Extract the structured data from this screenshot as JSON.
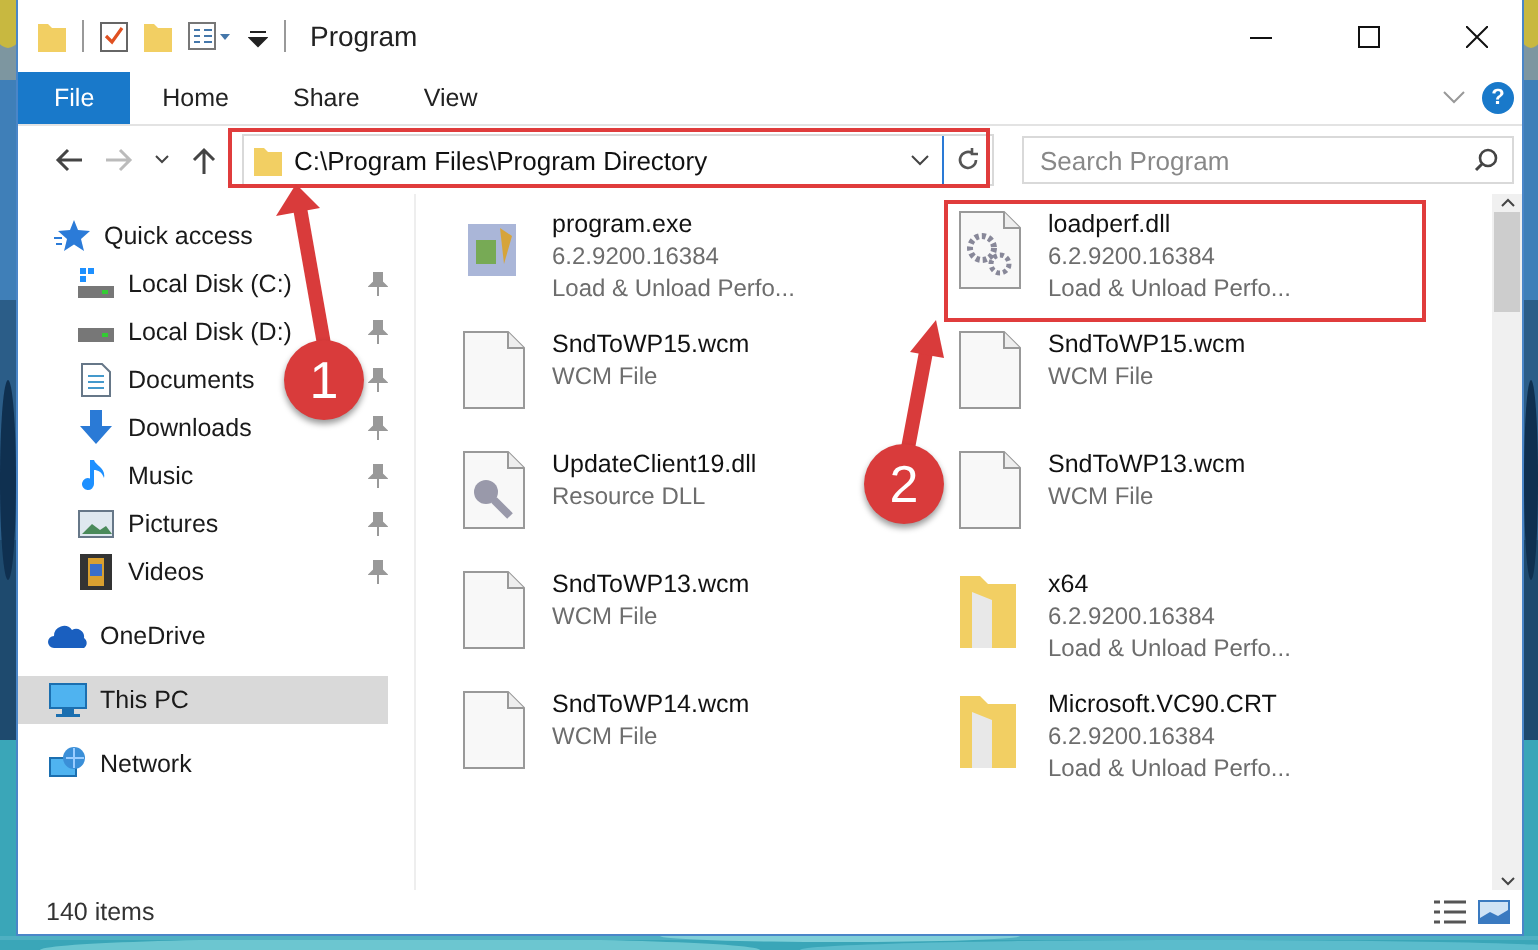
{
  "window": {
    "title": "Program"
  },
  "ribbon": {
    "tabs": [
      {
        "label": "File",
        "kind": "file"
      },
      {
        "label": "Home",
        "kind": "tab"
      },
      {
        "label": "Share",
        "kind": "tab"
      },
      {
        "label": "View",
        "kind": "tab"
      }
    ],
    "help": "?"
  },
  "address": {
    "path": "C:\\Program Files\\Program Directory"
  },
  "search": {
    "placeholder": "Search Program"
  },
  "nav": [
    {
      "label": "Quick access",
      "kind": "star",
      "selected": false,
      "children": [
        {
          "label": "Local Disk (C:)",
          "kind": "system",
          "pinned": true,
          "selected": false
        },
        {
          "label": "Local Disk (D:)",
          "kind": "drive",
          "pinned": true,
          "selected": false
        },
        {
          "label": "Documents",
          "kind": "documents",
          "pinned": true,
          "selected": false
        },
        {
          "label": "Downloads",
          "kind": "downloads",
          "pinned": true,
          "selected": false
        },
        {
          "label": "Music",
          "kind": "music",
          "pinned": true,
          "selected": false
        },
        {
          "label": "Pictures",
          "kind": "pictures",
          "pinned": true,
          "selected": false
        },
        {
          "label": "Videos",
          "kind": "videos",
          "pinned": true,
          "selected": false
        }
      ]
    },
    {
      "label": "OneDrive",
      "kind": "cloud",
      "selected": false
    },
    {
      "label": "This PC",
      "kind": "computer",
      "selected": true
    },
    {
      "label": "Network",
      "kind": "network",
      "selected": false
    }
  ],
  "files": [
    {
      "name": "program.exe",
      "details": [
        "6.2.9200.16384",
        "Load & Unload Perfo..."
      ],
      "kind": "program"
    },
    {
      "name": "loadperf.dll",
      "details": [
        "6.2.9200.16384",
        "Load & Unload Perfo..."
      ],
      "kind": "settings"
    },
    {
      "name": "SndToWP15.wcm",
      "details": [
        "WCM File"
      ],
      "kind": "document"
    },
    {
      "name": "SndToWP15.wcm",
      "details": [
        "WCM File"
      ],
      "kind": "document"
    },
    {
      "name": "UpdateClient19.dll",
      "details": [
        "Resource DLL"
      ],
      "kind": "resource"
    },
    {
      "name": "SndToWP13.wcm",
      "details": [
        "WCM File"
      ],
      "kind": "document"
    },
    {
      "name": "SndToWP13.wcm",
      "details": [
        "WCM File"
      ],
      "kind": "document"
    },
    {
      "name": "x64",
      "details": [
        "6.2.9200.16384",
        "Load & Unload Perfo..."
      ],
      "kind": "folder"
    },
    {
      "name": "SndToWP14.wcm",
      "details": [
        "WCM File"
      ],
      "kind": "document"
    },
    {
      "name": "Microsoft.VC90.CRT",
      "details": [
        "6.2.9200.16384",
        "Load & Unload Perfo..."
      ],
      "kind": "folder"
    }
  ],
  "status_bar": {
    "count": "140 items"
  },
  "annotations": [
    {
      "label": "1"
    },
    {
      "label": "2"
    }
  ]
}
